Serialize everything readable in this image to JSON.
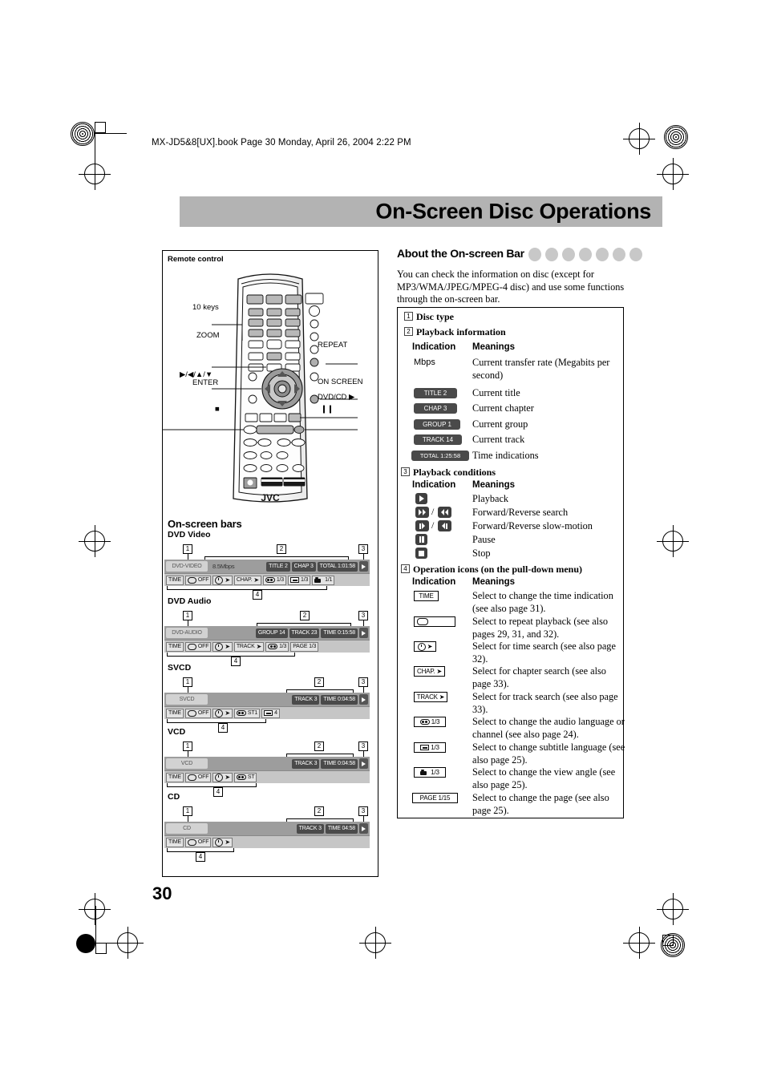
{
  "header": {
    "file_line": "MX-JD5&8[UX].book  Page 30  Monday, April 26, 2004  2:22 PM"
  },
  "title": "On-Screen Disc Operations",
  "page_number": "30",
  "left": {
    "remote_label": "Remote control",
    "callouts": {
      "ten_keys": "10 keys",
      "zoom": "ZOOM",
      "enter_line1": "▶/◀/▲/▼",
      "enter_line2": "ENTER",
      "repeat": "REPEAT",
      "on_screen": "ON SCREEN",
      "dvd_cd": "DVD/CD ▶",
      "pause": "❙❙",
      "stop": "■",
      "brand": "JVC"
    },
    "onscreen_bars_title": "On-screen bars",
    "bars": [
      {
        "name": "DVD Video",
        "disc": "DVD-VIDEO",
        "rate": "8.5Mbps",
        "info": [
          "TITLE  2",
          "CHAP  3",
          "TOTAL  1:01:58"
        ],
        "ops": [
          "TIME",
          "OFF",
          "",
          "CHAP.",
          "1/3",
          "1/3",
          "1/1"
        ]
      },
      {
        "name": "DVD Audio",
        "disc": "DVD-AUDIO",
        "rate": "",
        "info": [
          "GROUP 14",
          "TRACK 23",
          "TIME      0:15:58"
        ],
        "ops": [
          "TIME",
          "OFF",
          "",
          "TRACK",
          "1/3",
          "PAGE    1/3"
        ]
      },
      {
        "name": "SVCD",
        "disc": "SVCD",
        "rate": "",
        "info": [
          "TRACK  3",
          "TIME      0:04:58"
        ],
        "ops": [
          "TIME",
          "OFF",
          "",
          "ST1",
          "4"
        ]
      },
      {
        "name": "VCD",
        "disc": "VCD",
        "rate": "",
        "info": [
          "TRACK  3",
          "TIME      0:04:58"
        ],
        "ops": [
          "TIME",
          "OFF",
          "",
          "ST"
        ]
      },
      {
        "name": "CD",
        "disc": "CD",
        "rate": "",
        "info": [
          "TRACK  3",
          "TIME        04:58"
        ],
        "ops": [
          "TIME",
          "OFF",
          ""
        ]
      }
    ],
    "markers": [
      "1",
      "2",
      "3",
      "4"
    ]
  },
  "right": {
    "section_title": "About the On-screen Bar",
    "disc_badge_count": 7,
    "intro": "You can check the information on disc (except for MP3/WMA/JPEG/MPEG-4 disc) and use some functions through the on-screen bar.",
    "sections": [
      {
        "num": "1",
        "label": "Disc type"
      },
      {
        "num": "2",
        "label": "Playback information"
      },
      {
        "num": "3",
        "label": "Playback conditions"
      },
      {
        "num": "4",
        "label": "Operation icons (on the pull-down menu)"
      }
    ],
    "col_indication": "Indication",
    "col_meanings": "Meanings",
    "playback_information": [
      {
        "ind": "Mbps",
        "type": "text",
        "meaning": "Current transfer rate (Megabits per second)"
      },
      {
        "ind": "TITLE  2",
        "type": "chip",
        "meaning": "Current title"
      },
      {
        "ind": "CHAP  3",
        "type": "chip",
        "meaning": "Current chapter"
      },
      {
        "ind": "GROUP 1",
        "type": "chip",
        "meaning": "Current group"
      },
      {
        "ind": "TRACK 14",
        "type": "chip",
        "meaning": "Current track"
      },
      {
        "ind": "TOTAL 1:25:58",
        "type": "chip",
        "meaning": "Time indications"
      }
    ],
    "playback_conditions": [
      {
        "icon": "play-icon",
        "meaning": "Playback"
      },
      {
        "icon": "forward-reverse-search-icon",
        "meaning": "Forward/Reverse search"
      },
      {
        "icon": "forward-reverse-slow-icon",
        "meaning": "Forward/Reverse slow-motion"
      },
      {
        "icon": "pause-icon",
        "meaning": "Pause"
      },
      {
        "icon": "stop-icon",
        "meaning": "Stop"
      }
    ],
    "operation_icons": [
      {
        "icon": "time-icon",
        "label": "TIME",
        "meaning": "Select to change the time indication (see also page 31)."
      },
      {
        "icon": "repeat-icon",
        "label": "",
        "meaning": "Select to repeat playback (see also pages 29, 31, and 32)."
      },
      {
        "icon": "time-search-icon",
        "label": "",
        "meaning": "Select for time search (see also page 32)."
      },
      {
        "icon": "chapter-search-icon",
        "label": "CHAP.",
        "meaning": "Select for chapter search (see also page 33)."
      },
      {
        "icon": "track-search-icon",
        "label": "TRACK",
        "meaning": "Select for track search (see also page 33)."
      },
      {
        "icon": "audio-language-icon",
        "label": "1/3",
        "meaning": "Select to change the audio language or channel (see also page 24)."
      },
      {
        "icon": "subtitle-icon",
        "label": "1/3",
        "meaning": "Select to change subtitle language (see also page 25)."
      },
      {
        "icon": "view-angle-icon",
        "label": "1/3",
        "meaning": "Select to change the view angle (see also page 25)."
      },
      {
        "icon": "page-icon",
        "label": "PAGE 1/15",
        "meaning": "Select to change the page (see also page 25)."
      }
    ]
  }
}
